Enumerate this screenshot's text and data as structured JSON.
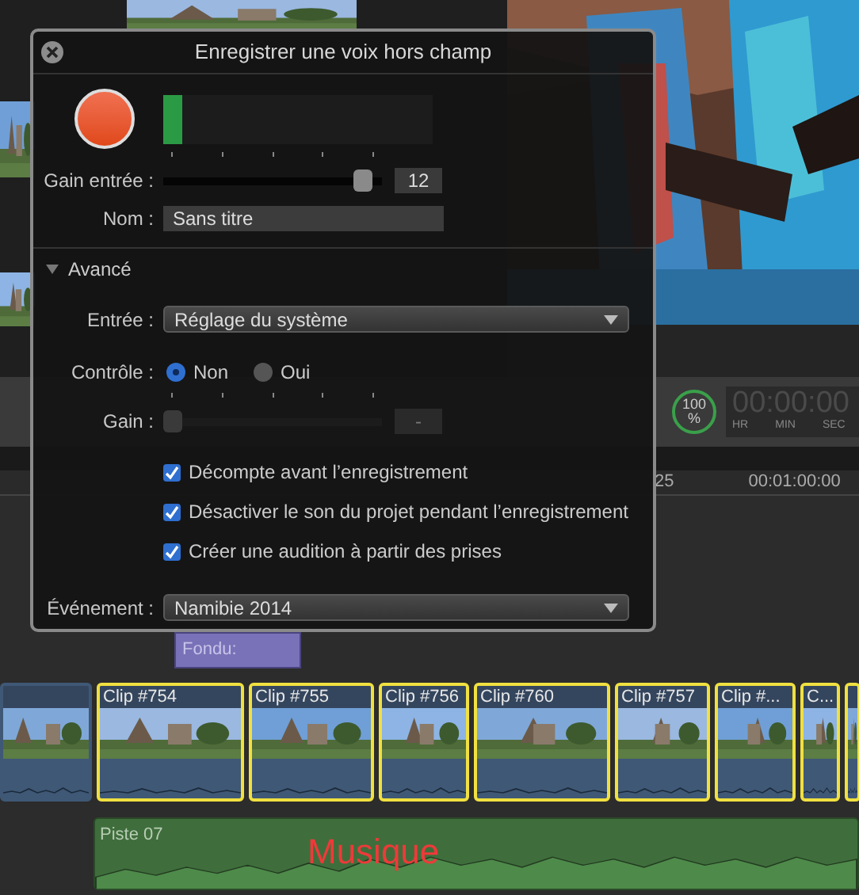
{
  "dialog": {
    "title": "Enregistrer une voix hors champ",
    "meter": {
      "level": 0.07
    },
    "input_gain": {
      "label": "Gain entrée :",
      "level": 0.95,
      "value": "12"
    },
    "name": {
      "label": "Nom :",
      "value": "Sans titre"
    },
    "advanced": {
      "label": "Avancé",
      "expanded": true
    },
    "input": {
      "label": "Entrée :",
      "value": "Réglage du système"
    },
    "monitor": {
      "label": "Contrôle :",
      "options": [
        {
          "label": "Non",
          "selected": true
        },
        {
          "label": "Oui",
          "selected": false
        }
      ]
    },
    "gain": {
      "label": "Gain :",
      "level": 0,
      "value": "-",
      "disabled": true
    },
    "options": [
      {
        "label": "Décompte avant l’enregistrement",
        "checked": true
      },
      {
        "label": "Désactiver le son du projet pendant l’enregistrement",
        "checked": true
      },
      {
        "label": "Créer une audition à partir des prises",
        "checked": true
      }
    ],
    "event": {
      "label": "Événement :",
      "value": "Namibie 2014"
    }
  },
  "toolbar": {
    "zoom": "100",
    "zoom_unit": "%",
    "timecode": "00:00:00",
    "timecode_units": [
      "HR",
      "MIN",
      "SEC"
    ]
  },
  "ruler": [
    "25",
    "00:01:00:00"
  ],
  "timeline": {
    "transition": "Fondu:",
    "clips": [
      {
        "selected": false
      },
      {
        "title": "Clip #754",
        "selected": true
      },
      {
        "title": "Clip #755",
        "selected": true
      },
      {
        "title": "Clip #756",
        "selected": true
      },
      {
        "title": "Clip #760",
        "selected": true
      },
      {
        "title": "Clip #757",
        "selected": true
      },
      {
        "title": "Clip #...",
        "selected": true
      },
      {
        "title": "C...",
        "selected": true
      },
      {
        "selected": true
      }
    ],
    "audio_track": {
      "title": "Piste 07",
      "annotation": "Musique"
    }
  }
}
